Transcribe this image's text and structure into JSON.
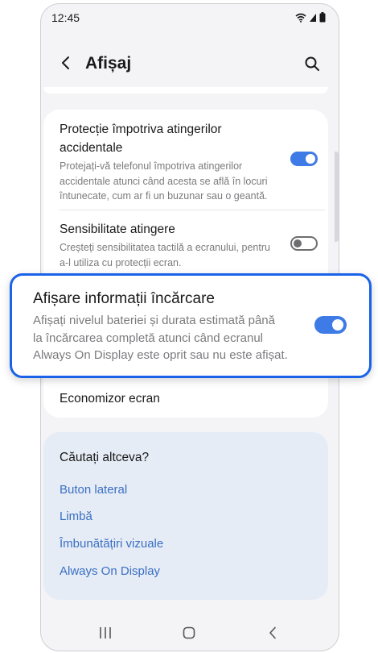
{
  "status_bar": {
    "time": "12:45",
    "icons": [
      "wifi-icon",
      "signal-icon",
      "battery-icon"
    ]
  },
  "app_bar": {
    "title": "Afișaj",
    "back_icon": "chevron-left-icon",
    "search_icon": "search-icon"
  },
  "settings": [
    {
      "title_line1": "Protecție împotriva atingerilor",
      "title_line2": "accidentale",
      "desc_line1": "Protejați-vă telefonul împotriva atingerilor",
      "desc_line2": "accidentale atunci când acesta se află în locuri",
      "desc_line3": "întunecate, cum ar fi un buzunar sau o geantă.",
      "enabled": true
    },
    {
      "title_line1": "Sensibilitate atingere",
      "desc_line1": "Creșteți sensibilitatea tactilă a ecranului, pentru",
      "desc_line2": "a-l utiliza cu protecții ecran.",
      "enabled": false
    },
    {
      "title_line1": "Economizor ecran"
    }
  ],
  "highlight": {
    "title": "Afișare informații încărcare",
    "desc_line1": "Afișați nivelul bateriei și durata estimată până",
    "desc_line2": "la încărcarea completă atunci când ecranul",
    "desc_line3": "Always On Display este oprit sau nu este afișat.",
    "enabled": true
  },
  "suggestions": {
    "heading": "Căutați altceva?",
    "links": [
      "Buton lateral",
      "Limbă",
      "Îmbunătățiri vizuale",
      "Always On Display"
    ]
  },
  "nav_bar": {
    "icons": [
      "recent-apps-icon",
      "home-icon",
      "back-icon"
    ]
  },
  "colors": {
    "accent": "#3e7be6",
    "link": "#3a6fc4",
    "highlight_border": "#1a63e8",
    "suggest_bg": "#e6ecf5"
  }
}
